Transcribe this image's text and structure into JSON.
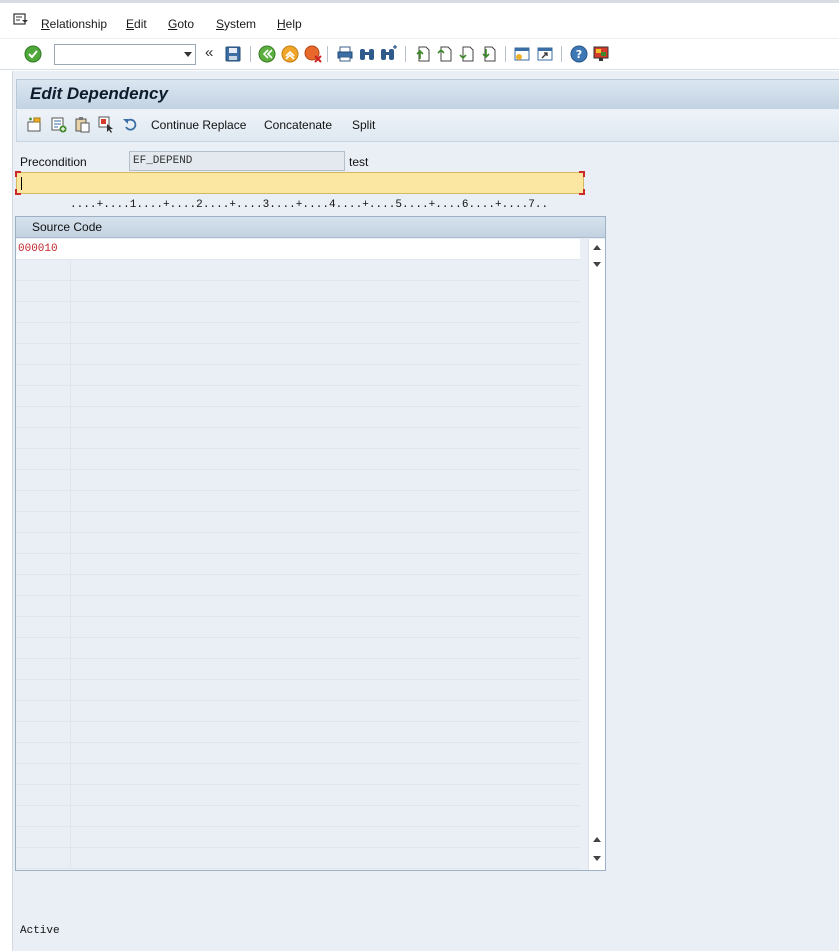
{
  "menu": {
    "items": [
      {
        "label": "Relationship",
        "accel": "R",
        "rest": "elationship"
      },
      {
        "label": "Edit",
        "accel": "E",
        "rest": "dit"
      },
      {
        "label": "Goto",
        "accel": "G",
        "rest": "oto"
      },
      {
        "label": "System",
        "accel": "S",
        "rest": "ystem"
      },
      {
        "label": "Help",
        "accel": "H",
        "rest": "elp"
      }
    ]
  },
  "toolbar": {
    "command_field_value": "",
    "back_chevrons": "«"
  },
  "page": {
    "title": "Edit Dependency"
  },
  "app_toolbar": {
    "continue_replace": "Continue Replace",
    "concatenate": "Concatenate",
    "split": "Split"
  },
  "precondition": {
    "label": "Precondition",
    "value": "EF_DEPEND",
    "description": "test"
  },
  "editor": {
    "ruler": "....+....1....+....2....+....3....+....4....+....5....+....6....+....7..",
    "header": "Source Code",
    "lines": [
      {
        "number": "000010",
        "text": ""
      }
    ]
  },
  "status": {
    "text": "Active"
  },
  "colors": {
    "work_background": "#e9eff5",
    "line_number": "#c0262c",
    "command_line_highlight": "#fbe7a1"
  }
}
